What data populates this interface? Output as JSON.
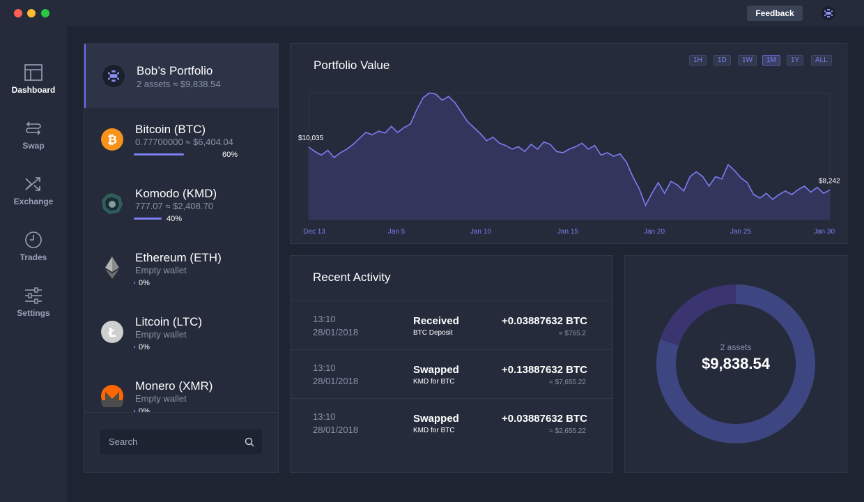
{
  "titlebar": {
    "feedback_label": "Feedback",
    "avatar_icon": "user-avatar-icon",
    "traffic_lights": [
      "#fe5f57",
      "#febc2e",
      "#28c840"
    ]
  },
  "nav": {
    "items": [
      {
        "label": "Dashboard",
        "icon": "dashboard-icon",
        "active": true
      },
      {
        "label": "Swap",
        "icon": "swap-icon",
        "active": false
      },
      {
        "label": "Exchange",
        "icon": "exchange-icon",
        "active": false
      },
      {
        "label": "Trades",
        "icon": "clock-icon",
        "active": false
      },
      {
        "label": "Settings",
        "icon": "sliders-icon",
        "active": false
      }
    ]
  },
  "wallets": {
    "portfolio": {
      "name": "Bob’s Portfolio",
      "sub": "2 assets ≈ $9,838.54",
      "icon": "portfolio-icon"
    },
    "items": [
      {
        "name": "Bitcoin (BTC)",
        "sub": "0.77700000 ≈ $6,404.04",
        "percent": 60,
        "percent_label": "60%",
        "icon": "bitcoin-icon"
      },
      {
        "name": "Komodo (KMD)",
        "sub": "777.07 ≈ $2,408.70",
        "percent": 40,
        "percent_label": "40%",
        "icon": "komodo-icon"
      },
      {
        "name": "Ethereum (ETH)",
        "sub": "Empty wallet",
        "percent": 0,
        "percent_label": "0%",
        "icon": "ethereum-icon"
      },
      {
        "name": "Litcoin (LTC)",
        "sub": "Empty wallet",
        "percent": 0,
        "percent_label": "0%",
        "icon": "litecoin-icon"
      },
      {
        "name": "Monero (XMR)",
        "sub": "Empty wallet",
        "percent": 0,
        "percent_label": "0%",
        "icon": "monero-icon"
      }
    ],
    "search_placeholder": "Search"
  },
  "portfolio_value": {
    "title": "Portfolio Value",
    "ranges": [
      "1H",
      "1D",
      "1W",
      "1M",
      "1Y",
      "ALL"
    ],
    "active_range": "1M",
    "start_label": "$10,035",
    "end_label": "$8,242"
  },
  "chart_data": {
    "type": "area",
    "title": "Portfolio Value",
    "x_tick_labels": [
      "Dec 13",
      "Jan 5",
      "Jan 10",
      "Jan 15",
      "Jan 20",
      "Jan 25",
      "Jan 30"
    ],
    "start_value": 10035,
    "end_value": 8242,
    "series": [
      {
        "color": "#7b7ff2",
        "values": [
          10035,
          9850,
          9700,
          9900,
          9600,
          9800,
          9950,
          10150,
          10400,
          10650,
          10550,
          10700,
          10620,
          10900,
          10650,
          10850,
          11000,
          11600,
          12100,
          12300,
          12250,
          12000,
          12150,
          11900,
          11500,
          11100,
          10850,
          10600,
          10300,
          10450,
          10200,
          10100,
          9950,
          10050,
          9850,
          10150,
          9950,
          10250,
          10150,
          9850,
          9800,
          9950,
          10050,
          10200,
          9950,
          10100,
          9700,
          9800,
          9650,
          9750,
          9400,
          8800,
          8300,
          7600,
          8100,
          8550,
          8100,
          8600,
          8450,
          8200,
          8800,
          9000,
          8800,
          8400,
          8800,
          8700,
          9300,
          9050,
          8750,
          8550,
          8050,
          7900,
          8100,
          7850,
          8050,
          8200,
          8050,
          8250,
          8400,
          8150,
          8350,
          8100,
          8242
        ]
      }
    ]
  },
  "activity": {
    "title": "Recent Activity",
    "rows": [
      {
        "time": "13:10",
        "date": "28/01/2018",
        "type": "Received",
        "desc": "BTC Deposit",
        "amount": "+0.03887632 BTC",
        "usd": "≈ $765.2"
      },
      {
        "time": "13:10",
        "date": "28/01/2018",
        "type": "Swapped",
        "desc": "KMD for BTC",
        "amount": "+0.13887632 BTC",
        "usd": "≈ $7,655.22"
      },
      {
        "time": "13:10",
        "date": "28/01/2018",
        "type": "Swapped",
        "desc": "KMD for BTC",
        "amount": "+0.03887632 BTC",
        "usd": "≈ $2,655.22"
      }
    ]
  },
  "donut": {
    "assets_label": "2 assets",
    "total": "$9,838.54",
    "segments": [
      {
        "label": "Bitcoin (BTC)",
        "percent": 80,
        "color": "#3d4680"
      },
      {
        "label": "Komodo (KMD)",
        "percent": 20,
        "color": "#3a3470"
      }
    ]
  }
}
